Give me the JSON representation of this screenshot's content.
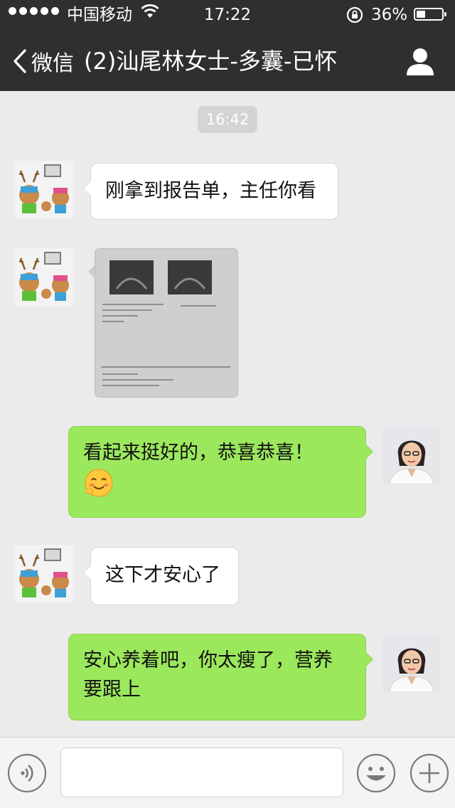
{
  "status_bar": {
    "carrier": "中国移动",
    "time": "17:22",
    "battery_percent_label": "36%",
    "battery_level": 0.36,
    "signal_dots": 5
  },
  "nav": {
    "back_label": "微信",
    "title": "(2)汕尾林女士-多囊-已怀",
    "profile_icon": "person-icon"
  },
  "chat": {
    "timestamp": "16:42",
    "messages": [
      {
        "from": "contact",
        "type": "text",
        "text": "刚拿到报告单，主任你看"
      },
      {
        "from": "contact",
        "type": "image",
        "image": "ultrasound-report-photo"
      },
      {
        "from": "me",
        "type": "text",
        "text": "看起来挺好的，恭喜恭喜！",
        "emoji": "blush-smile-emoji"
      },
      {
        "from": "contact",
        "type": "text",
        "text": "这下才安心了"
      },
      {
        "from": "me",
        "type": "text",
        "text": "安心养着吧，你太瘦了，营养要跟上"
      }
    ]
  },
  "input_bar": {
    "voice_icon": "voice-icon",
    "emoji_icon": "smiley-icon",
    "plus_icon": "plus-icon",
    "text_value": ""
  },
  "colors": {
    "nav_bg": "#2f2f31",
    "chat_bg": "#ebebeb",
    "outgoing_bubble": "#9ce85d",
    "incoming_bubble": "#ffffff"
  }
}
